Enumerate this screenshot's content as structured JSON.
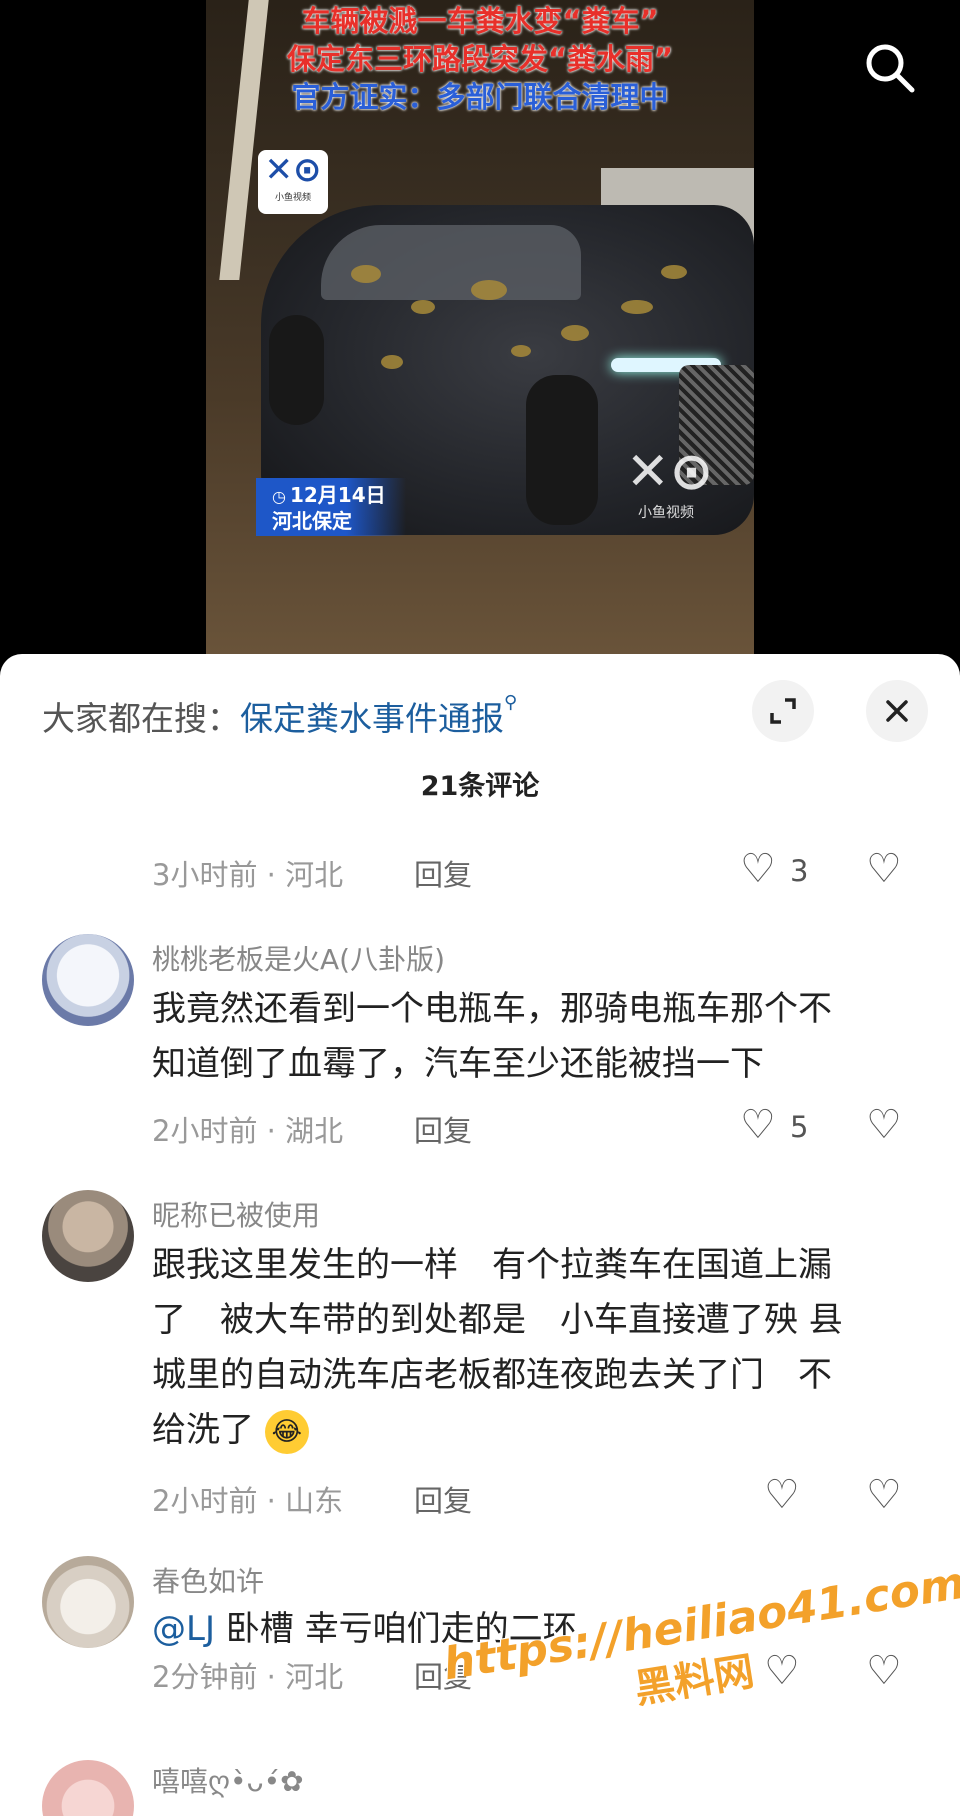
{
  "video": {
    "headline_line1": "车辆被溅一车粪水变“粪车”",
    "headline_line2": "保定东三环路段突发“粪水雨”",
    "headline_line3": "官方证实：多部门联合清理中",
    "channel_logo_mark": "✕⊙",
    "channel_logo_sub": "小鱼视频",
    "date": "12月14日",
    "location": "河北保定",
    "watermark_sub": "小鱼视频",
    "icon_search": "search-icon"
  },
  "sheet": {
    "hot_search_prefix": "大家都在搜：",
    "hot_search_link": "保定粪水事件通报",
    "hot_search_icon": "search-icon",
    "expand_icon": "expand-icon",
    "close_icon": "close-icon",
    "comment_count": "21条评论"
  },
  "comments": [
    {
      "time_location": "3小时前 · 河北",
      "reply": "回复",
      "likes": "3"
    },
    {
      "username": "桃桃老板是火A(八卦版)",
      "text_line1": "我竟然还看到一个电瓶车，那骑电瓶车那个不",
      "text_line2": "知道倒了血霉了，汽车至少还能被挡一下",
      "time_location": "2小时前 · 湖北",
      "reply": "回复",
      "likes": "5"
    },
    {
      "username": "昵称已被使用",
      "text_line1": "跟我这里发生的一样　有个拉粪车在国道上漏",
      "text_line2": "了　被大车带的到处都是　小车直接遭了殃 县",
      "text_line3": "城里的自动洗车店老板都连夜跑去关了门　不",
      "text_line4": "给洗了",
      "emoji": "😂",
      "time_location": "2小时前 · 山东",
      "reply": "回复",
      "likes": ""
    },
    {
      "username": "春色如许",
      "mention": "@LJ",
      "text": " 卧槽 幸亏咱们走的二环",
      "time_location": "2分钟前 · 河北",
      "reply": "回复",
      "likes": ""
    },
    {
      "username": "嘻嘻ღ•̀ᴗ•́✿"
    }
  ],
  "watermark": {
    "url": "https://heiliao41.com",
    "name": "黑料网"
  },
  "colors": {
    "headline_red": "#e8302a",
    "headline_blue": "#2a5fd8",
    "link_blue": "#1c5e9e",
    "watermark_orange": "#f3a12a"
  }
}
